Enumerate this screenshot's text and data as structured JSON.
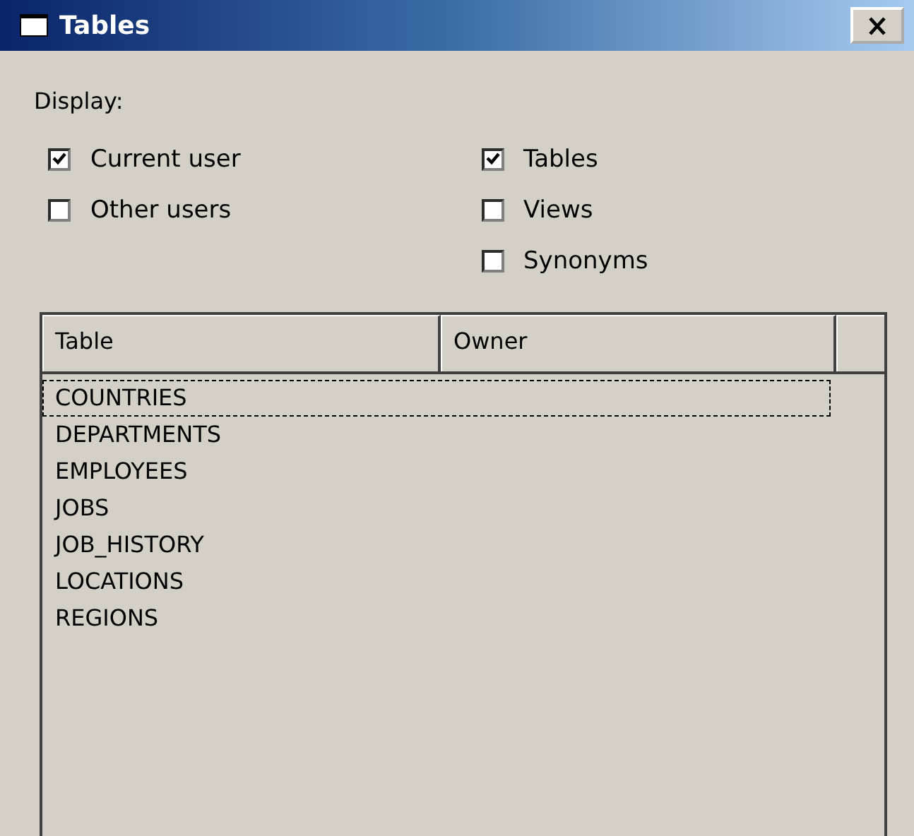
{
  "window": {
    "title": "Tables"
  },
  "display_label": "Display:",
  "owner_options": [
    {
      "label": "Current user",
      "checked": true
    },
    {
      "label": "Other users",
      "checked": false
    }
  ],
  "type_options": [
    {
      "label": "Tables",
      "checked": true
    },
    {
      "label": "Views",
      "checked": false
    },
    {
      "label": "Synonyms",
      "checked": false
    }
  ],
  "table": {
    "columns": [
      "Table",
      "Owner"
    ],
    "rows": [
      {
        "table": "COUNTRIES",
        "focused": true
      },
      {
        "table": "DEPARTMENTS",
        "focused": false
      },
      {
        "table": "EMPLOYEES",
        "focused": false
      },
      {
        "table": "JOBS",
        "focused": false
      },
      {
        "table": "JOB_HISTORY",
        "focused": false
      },
      {
        "table": "LOCATIONS",
        "focused": false
      },
      {
        "table": "REGIONS",
        "focused": false
      }
    ]
  }
}
